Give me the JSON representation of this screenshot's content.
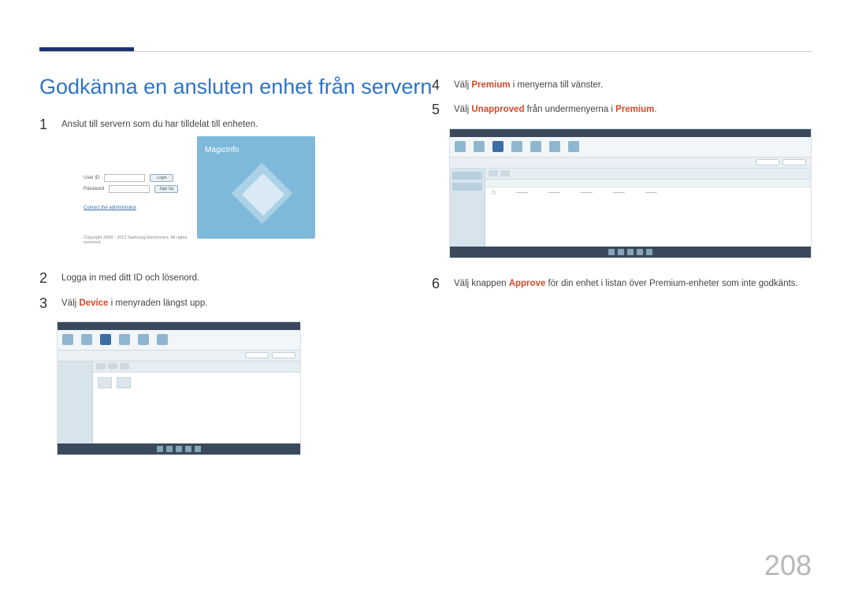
{
  "heading": "Godkänna en ansluten enhet från servern",
  "page_number": "208",
  "steps_left": [
    {
      "num": "1",
      "parts": [
        {
          "t": "Anslut till servern som du har tilldelat till enheten."
        }
      ]
    },
    {
      "num": "2",
      "parts": [
        {
          "t": "Logga in med ditt ID och lösenord."
        }
      ]
    },
    {
      "num": "3",
      "parts": [
        {
          "t": "Välj "
        },
        {
          "t": "Device",
          "hl": true
        },
        {
          "t": " i menyraden längst upp."
        }
      ]
    }
  ],
  "steps_right": [
    {
      "num": "4",
      "parts": [
        {
          "t": "Välj "
        },
        {
          "t": "Premium",
          "hl": true
        },
        {
          "t": " i menyerna till vänster."
        }
      ]
    },
    {
      "num": "5",
      "parts": [
        {
          "t": "Välj "
        },
        {
          "t": "Unapproved",
          "hl": true
        },
        {
          "t": " från undermenyerna i "
        },
        {
          "t": "Premium",
          "hl": true
        },
        {
          "t": "."
        }
      ]
    },
    {
      "num": "6",
      "parts": [
        {
          "t": "Välj knappen "
        },
        {
          "t": "Approve",
          "hl": true
        },
        {
          "t": " för din enhet i listan över Premium-enheter som inte godkänts."
        }
      ]
    }
  ],
  "login_shot": {
    "logo": "MagicInfo",
    "user_label": "User ID",
    "pass_label": "Password",
    "login_btn": "Login",
    "signup_btn": "Sign Up",
    "contact": "Contact the administrator",
    "copyright": "Copyright 2009 - 2013 Samsung Electronics. All rights reserved."
  }
}
